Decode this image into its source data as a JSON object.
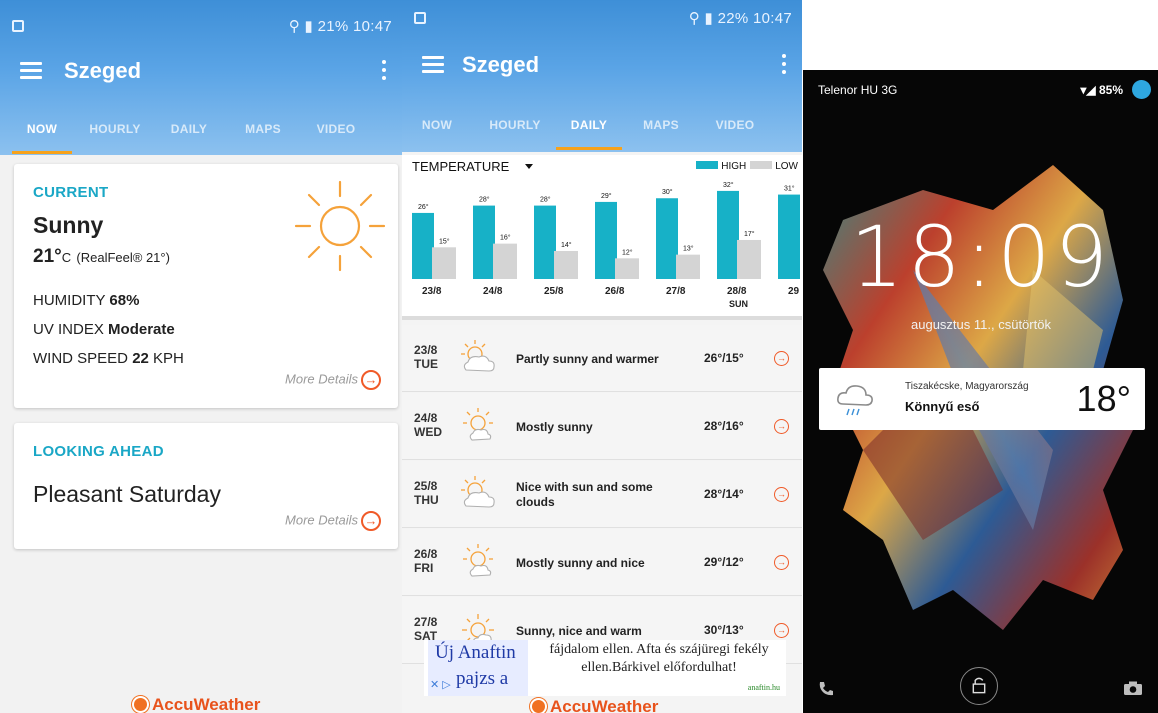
{
  "shared": {
    "city": "Szeged",
    "tabs": [
      "NOW",
      "HOURLY",
      "DAILY",
      "MAPS",
      "VIDEO"
    ],
    "brand": "AccuWeather",
    "colors": {
      "accent": "#1aa7c6",
      "tab_indicator": "#f7a21b",
      "orange": "#f05a28",
      "header_blue": "#4a97dd"
    }
  },
  "phone1": {
    "status": "21% 10:47",
    "current": {
      "label": "CURRENT",
      "condition": "Sunny",
      "temp": "21°",
      "temp_unit": "C",
      "realfeel": "(RealFeel® 21°)",
      "humidity_label": "HUMIDITY",
      "humidity_value": "68%",
      "uv_label": "UV INDEX",
      "uv_value": "Moderate",
      "wind_label": "WIND SPEED",
      "wind_value": "22",
      "wind_unit": "KPH",
      "more": "More Details",
      "icon": "sun-icon"
    },
    "ahead": {
      "label": "LOOKING AHEAD",
      "text": "Pleasant Saturday",
      "more": "More Details"
    }
  },
  "phone2": {
    "status": "22% 10:47",
    "metric": "TEMPERATURE",
    "legend_high": "HIGH",
    "legend_low": "LOW",
    "high_color": "#17b1c7",
    "low_color": "#d4d4d4",
    "chart_data": {
      "type": "bar",
      "title": "",
      "categories": [
        "23/8",
        "24/8",
        "25/8",
        "26/8",
        "27/8",
        "28/8",
        "29"
      ],
      "series": [
        {
          "name": "HIGH",
          "values": [
            26,
            28,
            28,
            29,
            30,
            32,
            31
          ]
        },
        {
          "name": "LOW",
          "values": [
            15,
            16,
            14,
            12,
            13,
            17,
            null
          ]
        }
      ],
      "value_labels_high": [
        "26°",
        "28°",
        "28°",
        "29°",
        "30°",
        "32°",
        "31°"
      ],
      "value_labels_low": [
        "15°",
        "16°",
        "14°",
        "12°",
        "13°",
        "17°",
        ""
      ],
      "sublabels": [
        "",
        "",
        "",
        "",
        "",
        "SUN",
        ""
      ],
      "ylim": [
        0,
        34
      ],
      "legend": "top-right",
      "grid": false
    },
    "days": [
      {
        "date": "23/8",
        "dow": "TUE",
        "text": "Partly sunny and warmer",
        "temp": "26°/15°",
        "icon": "partly-sunny-icon"
      },
      {
        "date": "24/8",
        "dow": "WED",
        "text": "Mostly sunny",
        "temp": "28°/16°",
        "icon": "mostly-sunny-icon"
      },
      {
        "date": "25/8",
        "dow": "THU",
        "text": "Nice with sun and some clouds",
        "temp": "28°/14°",
        "icon": "partly-sunny-icon"
      },
      {
        "date": "26/8",
        "dow": "FRI",
        "text": "Mostly sunny and nice",
        "temp": "29°/12°",
        "icon": "mostly-sunny-icon"
      },
      {
        "date": "27/8",
        "dow": "SAT",
        "text": "Sunny, nice and warm",
        "temp": "30°/13°",
        "icon": "sun-icon"
      }
    ],
    "ad": {
      "brand_line1": "Új Anaftin",
      "brand_line2": "pajzs a",
      "copy": "fájdalom ellen. Afta és szájüregi fekély ellen.Bárkivel előfordulhat!",
      "url": "anaftin.hu"
    }
  },
  "phone3": {
    "carrier": "Telenor HU 3G",
    "battery": "85%",
    "time": "18:09",
    "date": "augusztus 11., csütörtök",
    "widget": {
      "location": "Tiszakécske, Magyarország",
      "condition": "Könnyű eső",
      "temp": "18°",
      "icon": "rain-cloud-icon"
    }
  }
}
